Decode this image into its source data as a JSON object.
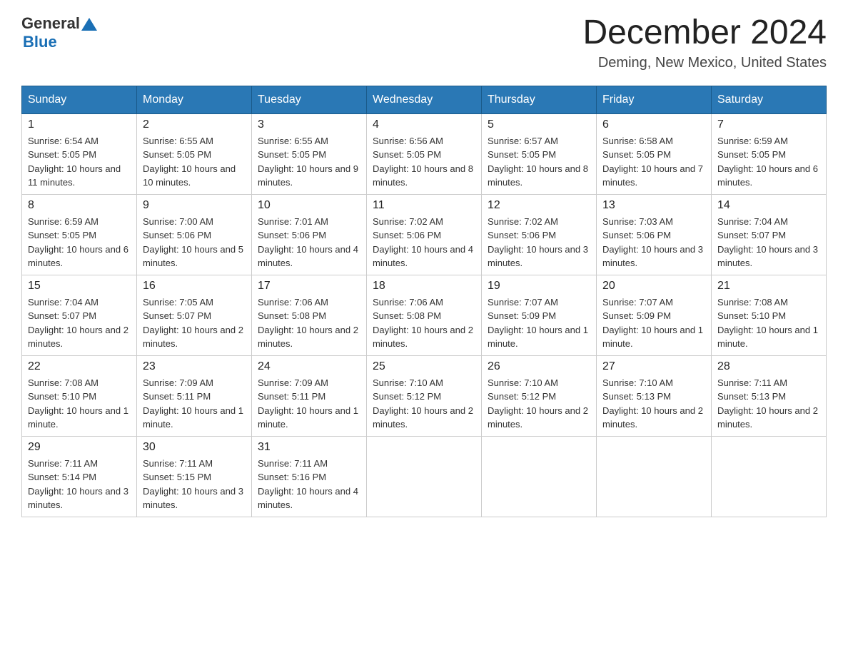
{
  "header": {
    "logo_general": "General",
    "logo_blue": "Blue",
    "month_title": "December 2024",
    "location": "Deming, New Mexico, United States"
  },
  "days_of_week": [
    "Sunday",
    "Monday",
    "Tuesday",
    "Wednesday",
    "Thursday",
    "Friday",
    "Saturday"
  ],
  "weeks": [
    [
      {
        "day": "1",
        "sunrise": "6:54 AM",
        "sunset": "5:05 PM",
        "daylight": "10 hours and 11 minutes."
      },
      {
        "day": "2",
        "sunrise": "6:55 AM",
        "sunset": "5:05 PM",
        "daylight": "10 hours and 10 minutes."
      },
      {
        "day": "3",
        "sunrise": "6:55 AM",
        "sunset": "5:05 PM",
        "daylight": "10 hours and 9 minutes."
      },
      {
        "day": "4",
        "sunrise": "6:56 AM",
        "sunset": "5:05 PM",
        "daylight": "10 hours and 8 minutes."
      },
      {
        "day": "5",
        "sunrise": "6:57 AM",
        "sunset": "5:05 PM",
        "daylight": "10 hours and 8 minutes."
      },
      {
        "day": "6",
        "sunrise": "6:58 AM",
        "sunset": "5:05 PM",
        "daylight": "10 hours and 7 minutes."
      },
      {
        "day": "7",
        "sunrise": "6:59 AM",
        "sunset": "5:05 PM",
        "daylight": "10 hours and 6 minutes."
      }
    ],
    [
      {
        "day": "8",
        "sunrise": "6:59 AM",
        "sunset": "5:05 PM",
        "daylight": "10 hours and 6 minutes."
      },
      {
        "day": "9",
        "sunrise": "7:00 AM",
        "sunset": "5:06 PM",
        "daylight": "10 hours and 5 minutes."
      },
      {
        "day": "10",
        "sunrise": "7:01 AM",
        "sunset": "5:06 PM",
        "daylight": "10 hours and 4 minutes."
      },
      {
        "day": "11",
        "sunrise": "7:02 AM",
        "sunset": "5:06 PM",
        "daylight": "10 hours and 4 minutes."
      },
      {
        "day": "12",
        "sunrise": "7:02 AM",
        "sunset": "5:06 PM",
        "daylight": "10 hours and 3 minutes."
      },
      {
        "day": "13",
        "sunrise": "7:03 AM",
        "sunset": "5:06 PM",
        "daylight": "10 hours and 3 minutes."
      },
      {
        "day": "14",
        "sunrise": "7:04 AM",
        "sunset": "5:07 PM",
        "daylight": "10 hours and 3 minutes."
      }
    ],
    [
      {
        "day": "15",
        "sunrise": "7:04 AM",
        "sunset": "5:07 PM",
        "daylight": "10 hours and 2 minutes."
      },
      {
        "day": "16",
        "sunrise": "7:05 AM",
        "sunset": "5:07 PM",
        "daylight": "10 hours and 2 minutes."
      },
      {
        "day": "17",
        "sunrise": "7:06 AM",
        "sunset": "5:08 PM",
        "daylight": "10 hours and 2 minutes."
      },
      {
        "day": "18",
        "sunrise": "7:06 AM",
        "sunset": "5:08 PM",
        "daylight": "10 hours and 2 minutes."
      },
      {
        "day": "19",
        "sunrise": "7:07 AM",
        "sunset": "5:09 PM",
        "daylight": "10 hours and 1 minute."
      },
      {
        "day": "20",
        "sunrise": "7:07 AM",
        "sunset": "5:09 PM",
        "daylight": "10 hours and 1 minute."
      },
      {
        "day": "21",
        "sunrise": "7:08 AM",
        "sunset": "5:10 PM",
        "daylight": "10 hours and 1 minute."
      }
    ],
    [
      {
        "day": "22",
        "sunrise": "7:08 AM",
        "sunset": "5:10 PM",
        "daylight": "10 hours and 1 minute."
      },
      {
        "day": "23",
        "sunrise": "7:09 AM",
        "sunset": "5:11 PM",
        "daylight": "10 hours and 1 minute."
      },
      {
        "day": "24",
        "sunrise": "7:09 AM",
        "sunset": "5:11 PM",
        "daylight": "10 hours and 1 minute."
      },
      {
        "day": "25",
        "sunrise": "7:10 AM",
        "sunset": "5:12 PM",
        "daylight": "10 hours and 2 minutes."
      },
      {
        "day": "26",
        "sunrise": "7:10 AM",
        "sunset": "5:12 PM",
        "daylight": "10 hours and 2 minutes."
      },
      {
        "day": "27",
        "sunrise": "7:10 AM",
        "sunset": "5:13 PM",
        "daylight": "10 hours and 2 minutes."
      },
      {
        "day": "28",
        "sunrise": "7:11 AM",
        "sunset": "5:13 PM",
        "daylight": "10 hours and 2 minutes."
      }
    ],
    [
      {
        "day": "29",
        "sunrise": "7:11 AM",
        "sunset": "5:14 PM",
        "daylight": "10 hours and 3 minutes."
      },
      {
        "day": "30",
        "sunrise": "7:11 AM",
        "sunset": "5:15 PM",
        "daylight": "10 hours and 3 minutes."
      },
      {
        "day": "31",
        "sunrise": "7:11 AM",
        "sunset": "5:16 PM",
        "daylight": "10 hours and 4 minutes."
      },
      null,
      null,
      null,
      null
    ]
  ]
}
